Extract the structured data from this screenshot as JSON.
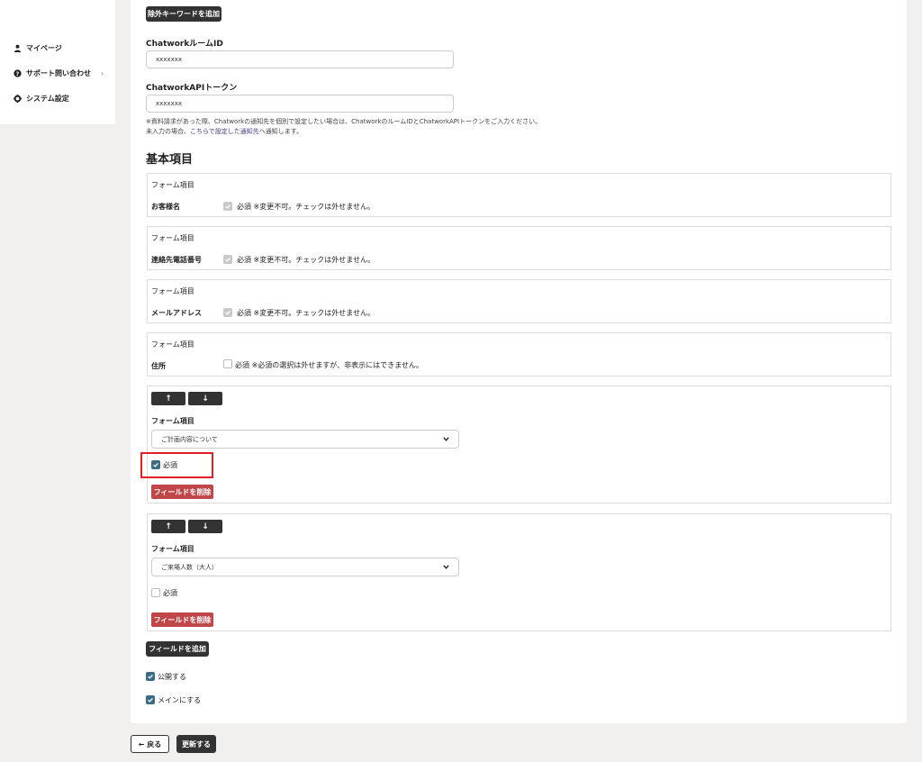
{
  "sidebar": {
    "items": [
      {
        "label": "マイページ",
        "icon": "user-icon"
      },
      {
        "label": "サポート問い合わせ",
        "icon": "help-circle-icon",
        "chevron": "›"
      },
      {
        "label": "システム設定",
        "icon": "gear-icon"
      }
    ]
  },
  "form": {
    "add_exclude_keyword_label": "除外キーワードを追加",
    "room_id_label": "ChatworkルームID",
    "room_id_value": "xxxxxxx",
    "api_token_label": "ChatworkAPIトークン",
    "api_token_value": "xxxxxxx",
    "note_line1": "※資料請求があった際、Chatworkの通知先を個別で設定したい場合は、ChatworkのルームIDとChatworkAPIトークンをご入力ください。",
    "note_line2_prefix": "未入力の場合、",
    "note_line2_link": "こちらで設定した通知先",
    "note_line2_suffix": "へ通知します。",
    "section_title": "基本項目",
    "fixed_fields": [
      {
        "group_label": "フォーム項目",
        "name": "お客様名",
        "required_text": "必須 ※変更不可。チェックは外せません。",
        "checked": true,
        "disabled": true
      },
      {
        "group_label": "フォーム項目",
        "name": "連絡先電話番号",
        "required_text": "必須 ※変更不可。チェックは外せません。",
        "checked": true,
        "disabled": true
      },
      {
        "group_label": "フォーム項目",
        "name": "メールアドレス",
        "required_text": "必須 ※変更不可。チェックは外せません。",
        "checked": true,
        "disabled": true
      },
      {
        "group_label": "フォーム項目",
        "name": "住所",
        "required_text": "必須 ※必須の選択は外せますが、非表示にはできません。",
        "checked": false,
        "disabled": false
      }
    ],
    "custom_fields": [
      {
        "up": "↑",
        "down": "↓",
        "group_label": "フォーム項目",
        "selected": "ご計画内容について",
        "required_label": "必須",
        "required": true,
        "delete_label": "フィールドを削除"
      },
      {
        "up": "↑",
        "down": "↓",
        "group_label": "フォーム項目",
        "selected": "ご来場人数（大人）",
        "required_label": "必須",
        "required": false,
        "delete_label": "フィールドを削除"
      }
    ],
    "add_field_label": "フィールドを追加",
    "publish_label": "公開する",
    "publish_checked": true,
    "main_label": "メインにする",
    "main_checked": true
  },
  "footer": {
    "back_label": "← 戻る",
    "update_label": "更新する"
  },
  "colors": {
    "accent_checkbox": "#3b6b86",
    "delete_red": "#c0464a",
    "highlight_red": "#e01f26",
    "dark_button": "#333333"
  }
}
